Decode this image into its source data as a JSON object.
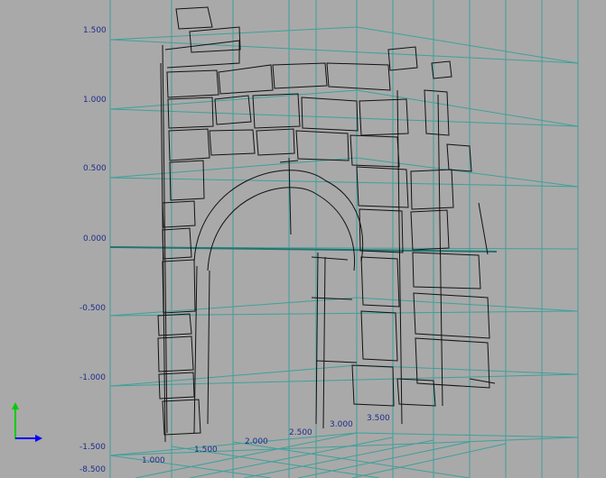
{
  "viewport": {
    "background_color": "#a9a9a9",
    "grid_color": "#3fa09a",
    "label_color": "#1f2d8a",
    "drawing_color": "#111111"
  },
  "vertical_axis_labels": [
    "1.500",
    "1.000",
    "0.500",
    "0.000",
    "-0.500",
    "-1.000",
    "-1.500",
    "-8.500"
  ],
  "horizontal_axis_labels": [
    "1.000",
    "1.500",
    "2.000",
    "2.500",
    "3.000",
    "3.500"
  ],
  "axis_gizmo": {
    "y_color": "#00cc00",
    "x_color": "#0000ff"
  }
}
